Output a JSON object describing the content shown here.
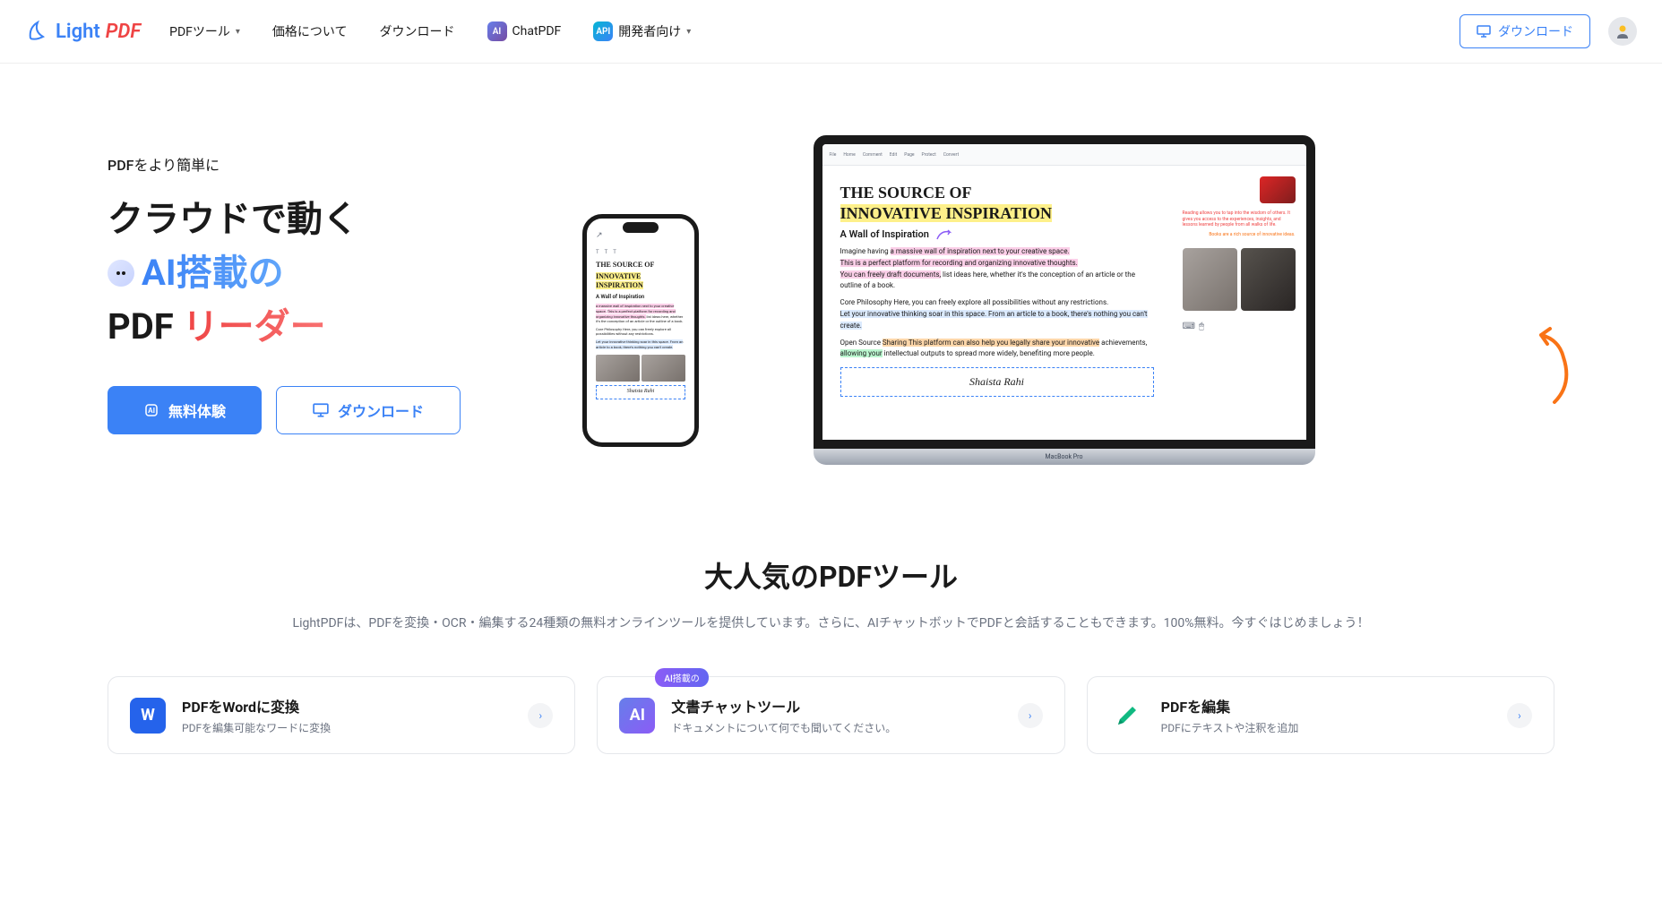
{
  "header": {
    "logo": {
      "light": "Light",
      "pdf": "PDF"
    },
    "nav": {
      "pdf_tools": "PDFツール",
      "pricing": "価格について",
      "download": "ダウンロード",
      "chatpdf": "ChatPDF",
      "developer": "開発者向け",
      "ai_badge": "AI",
      "api_badge": "API"
    },
    "download_btn": "ダウンロード"
  },
  "hero": {
    "subtitle": "PDFをより簡単に",
    "title_line1": "クラウドで動く",
    "title_ai": "AI搭載の",
    "title_pdf": "PDF",
    "title_reader": "リーダー",
    "cta_primary": "無料体験",
    "cta_secondary": "ダウンロード",
    "device": {
      "laptop_label": "MacBook Pro",
      "doc_title": "THE SOURCE OF",
      "doc_highlight": "INNOVATIVE INSPIRATION",
      "doc_subtitle": "A Wall of Inspiration",
      "doc_p1_pre": "Imagine having ",
      "doc_p1_hl": "a massive wall of inspiration next to your creative space.",
      "doc_p2_hl": "This is a perfect platform for recording and organizing innovative thoughts.",
      "doc_p3_hl_a": "You can freely draft documents,",
      "doc_p3_rest": " list ideas here, whether it's the conception of an article or the outline of a book.",
      "doc_p4": "Core Philosophy Here, you can freely explore all possibilities without any restrictions. ",
      "doc_p4_hl": "Let your innovative thinking soar in this space. From an article to a book, there's nothing you can't create.",
      "doc_p5_pre": "Open Source ",
      "doc_p5_hl1": "Sharing This platform can also help you legally share your innovative",
      "doc_p5_mid": " achievements, ",
      "doc_p5_hl2": "allowing your",
      "doc_p5_rest": " intellectual outputs to spread more widely, benefiting more people.",
      "signature": "Shaista Rahi",
      "sidebar_note1": "Reading allows you to tap into the wisdom of others. It gives you access to the experiences, insights, and lessons learned by people from all walks of life.",
      "sidebar_note2": "Books are a rich source of innovative ideas."
    }
  },
  "tools": {
    "title": "大人気のPDFツール",
    "description": "LightPDFは、PDFを変換・OCR・編集する24種類の無料オンラインツールを提供しています。さらに、AIチャットボットでPDFと会話することもできます。100%無料。今すぐはじめましょう！",
    "cards": [
      {
        "title": "PDFをWordに変換",
        "subtitle": "PDFを編集可能なワードに変換",
        "icon": "W"
      },
      {
        "badge": "AI搭載の",
        "title": "文書チャットツール",
        "subtitle": "ドキュメントについて何でも聞いてください。",
        "icon": "AI"
      },
      {
        "title": "PDFを編集",
        "subtitle": "PDFにテキストや注釈を追加"
      }
    ]
  }
}
